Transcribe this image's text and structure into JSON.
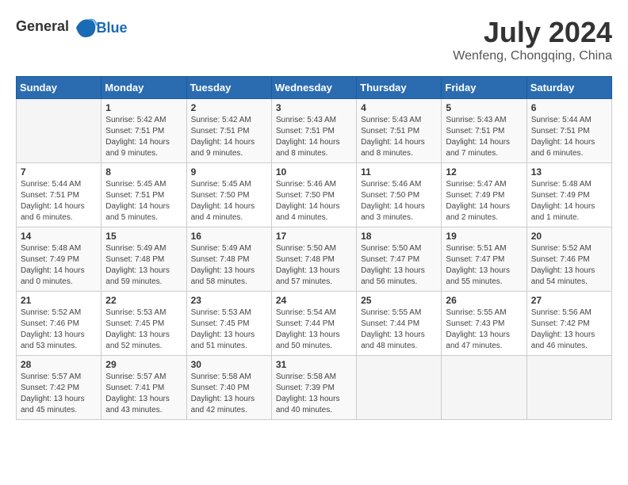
{
  "header": {
    "logo_general": "General",
    "logo_blue": "Blue",
    "month_year": "July 2024",
    "location": "Wenfeng, Chongqing, China"
  },
  "calendar": {
    "days_of_week": [
      "Sunday",
      "Monday",
      "Tuesday",
      "Wednesday",
      "Thursday",
      "Friday",
      "Saturday"
    ],
    "weeks": [
      [
        {
          "day": "",
          "content": ""
        },
        {
          "day": "1",
          "content": "Sunrise: 5:42 AM\nSunset: 7:51 PM\nDaylight: 14 hours\nand 9 minutes."
        },
        {
          "day": "2",
          "content": "Sunrise: 5:42 AM\nSunset: 7:51 PM\nDaylight: 14 hours\nand 9 minutes."
        },
        {
          "day": "3",
          "content": "Sunrise: 5:43 AM\nSunset: 7:51 PM\nDaylight: 14 hours\nand 8 minutes."
        },
        {
          "day": "4",
          "content": "Sunrise: 5:43 AM\nSunset: 7:51 PM\nDaylight: 14 hours\nand 8 minutes."
        },
        {
          "day": "5",
          "content": "Sunrise: 5:43 AM\nSunset: 7:51 PM\nDaylight: 14 hours\nand 7 minutes."
        },
        {
          "day": "6",
          "content": "Sunrise: 5:44 AM\nSunset: 7:51 PM\nDaylight: 14 hours\nand 6 minutes."
        }
      ],
      [
        {
          "day": "7",
          "content": "Sunrise: 5:44 AM\nSunset: 7:51 PM\nDaylight: 14 hours\nand 6 minutes."
        },
        {
          "day": "8",
          "content": "Sunrise: 5:45 AM\nSunset: 7:51 PM\nDaylight: 14 hours\nand 5 minutes."
        },
        {
          "day": "9",
          "content": "Sunrise: 5:45 AM\nSunset: 7:50 PM\nDaylight: 14 hours\nand 4 minutes."
        },
        {
          "day": "10",
          "content": "Sunrise: 5:46 AM\nSunset: 7:50 PM\nDaylight: 14 hours\nand 4 minutes."
        },
        {
          "day": "11",
          "content": "Sunrise: 5:46 AM\nSunset: 7:50 PM\nDaylight: 14 hours\nand 3 minutes."
        },
        {
          "day": "12",
          "content": "Sunrise: 5:47 AM\nSunset: 7:49 PM\nDaylight: 14 hours\nand 2 minutes."
        },
        {
          "day": "13",
          "content": "Sunrise: 5:48 AM\nSunset: 7:49 PM\nDaylight: 14 hours\nand 1 minute."
        }
      ],
      [
        {
          "day": "14",
          "content": "Sunrise: 5:48 AM\nSunset: 7:49 PM\nDaylight: 14 hours\nand 0 minutes."
        },
        {
          "day": "15",
          "content": "Sunrise: 5:49 AM\nSunset: 7:48 PM\nDaylight: 13 hours\nand 59 minutes."
        },
        {
          "day": "16",
          "content": "Sunrise: 5:49 AM\nSunset: 7:48 PM\nDaylight: 13 hours\nand 58 minutes."
        },
        {
          "day": "17",
          "content": "Sunrise: 5:50 AM\nSunset: 7:48 PM\nDaylight: 13 hours\nand 57 minutes."
        },
        {
          "day": "18",
          "content": "Sunrise: 5:50 AM\nSunset: 7:47 PM\nDaylight: 13 hours\nand 56 minutes."
        },
        {
          "day": "19",
          "content": "Sunrise: 5:51 AM\nSunset: 7:47 PM\nDaylight: 13 hours\nand 55 minutes."
        },
        {
          "day": "20",
          "content": "Sunrise: 5:52 AM\nSunset: 7:46 PM\nDaylight: 13 hours\nand 54 minutes."
        }
      ],
      [
        {
          "day": "21",
          "content": "Sunrise: 5:52 AM\nSunset: 7:46 PM\nDaylight: 13 hours\nand 53 minutes."
        },
        {
          "day": "22",
          "content": "Sunrise: 5:53 AM\nSunset: 7:45 PM\nDaylight: 13 hours\nand 52 minutes."
        },
        {
          "day": "23",
          "content": "Sunrise: 5:53 AM\nSunset: 7:45 PM\nDaylight: 13 hours\nand 51 minutes."
        },
        {
          "day": "24",
          "content": "Sunrise: 5:54 AM\nSunset: 7:44 PM\nDaylight: 13 hours\nand 50 minutes."
        },
        {
          "day": "25",
          "content": "Sunrise: 5:55 AM\nSunset: 7:44 PM\nDaylight: 13 hours\nand 48 minutes."
        },
        {
          "day": "26",
          "content": "Sunrise: 5:55 AM\nSunset: 7:43 PM\nDaylight: 13 hours\nand 47 minutes."
        },
        {
          "day": "27",
          "content": "Sunrise: 5:56 AM\nSunset: 7:42 PM\nDaylight: 13 hours\nand 46 minutes."
        }
      ],
      [
        {
          "day": "28",
          "content": "Sunrise: 5:57 AM\nSunset: 7:42 PM\nDaylight: 13 hours\nand 45 minutes."
        },
        {
          "day": "29",
          "content": "Sunrise: 5:57 AM\nSunset: 7:41 PM\nDaylight: 13 hours\nand 43 minutes."
        },
        {
          "day": "30",
          "content": "Sunrise: 5:58 AM\nSunset: 7:40 PM\nDaylight: 13 hours\nand 42 minutes."
        },
        {
          "day": "31",
          "content": "Sunrise: 5:58 AM\nSunset: 7:39 PM\nDaylight: 13 hours\nand 40 minutes."
        },
        {
          "day": "",
          "content": ""
        },
        {
          "day": "",
          "content": ""
        },
        {
          "day": "",
          "content": ""
        }
      ]
    ]
  }
}
